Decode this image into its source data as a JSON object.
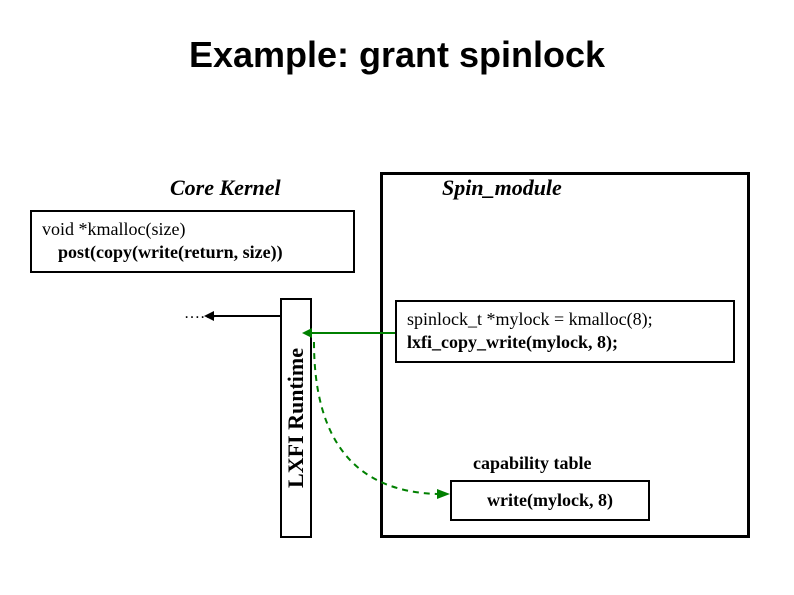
{
  "title": "Example: grant spinlock",
  "core_kernel": "Core Kernel",
  "spin_module": "Spin_module",
  "kmalloc": {
    "line1": "void *kmalloc(size)",
    "line2": "post(copy(write(return, size))"
  },
  "ellipsis": "……",
  "runtime_label": "LXFI Runtime",
  "mylock": {
    "line1": "spinlock_t *mylock = kmalloc(8);",
    "line2": "lxfi_copy_write(mylock, 8);"
  },
  "capability_table": "capability table",
  "write_entry": "write(mylock, 8)"
}
